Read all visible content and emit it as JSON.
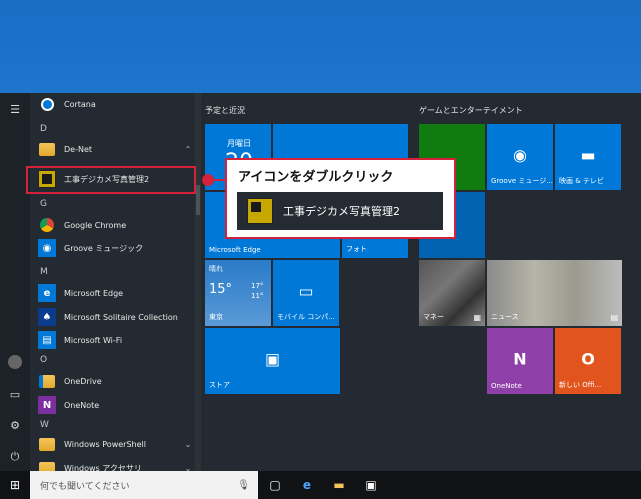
{
  "colors": {
    "desktop": "#1b72c9",
    "start_bg": "#232a31",
    "tile_blue": "#0078d7",
    "tile_green": "#107c10",
    "tile_purple": "#8e3fa8",
    "tile_orange": "#e2541d",
    "callout_red": "#d6213b"
  },
  "app_list": {
    "letters": {
      "d": "D",
      "g": "G",
      "m": "M",
      "o": "O",
      "w": "W"
    },
    "items": {
      "cortana": "Cortana",
      "denet": "De-Net",
      "koji": "工事デジカメ写真管理2",
      "chrome": "Google Chrome",
      "groove": "Groove ミュージック",
      "edge": "Microsoft Edge",
      "solitaire": "Microsoft Solitaire Collection",
      "wifi": "Microsoft Wi-Fi",
      "onedrive": "OneDrive",
      "onenote": "OneNote",
      "powershell": "Windows PowerShell",
      "accessories": "Windows アクセサリ"
    }
  },
  "tiles": {
    "group1": "予定と近況",
    "group2": "ゲームとエンターテイメント",
    "calendar_day": "月曜日",
    "calendar_date": "20",
    "edge": "Microsoft Edge",
    "photos": "フォト",
    "weather_cond": "晴れ",
    "weather_temp": "15°",
    "weather_hi": "17°",
    "weather_lo": "11°",
    "weather_city": "東京",
    "mobile": "モバイル コンパ...",
    "store": "ストア",
    "groove": "Groove ミュージ...",
    "movies": "映画 & テレビ",
    "money": "マネー",
    "news": "ニュース",
    "onenote": "OneNote",
    "office": "新しい Offi..."
  },
  "callout": {
    "title": "アイコンをダブルクリック",
    "app_label": "工事デジカメ写真管理2"
  },
  "taskbar": {
    "search_placeholder": "何でも聞いてください"
  }
}
